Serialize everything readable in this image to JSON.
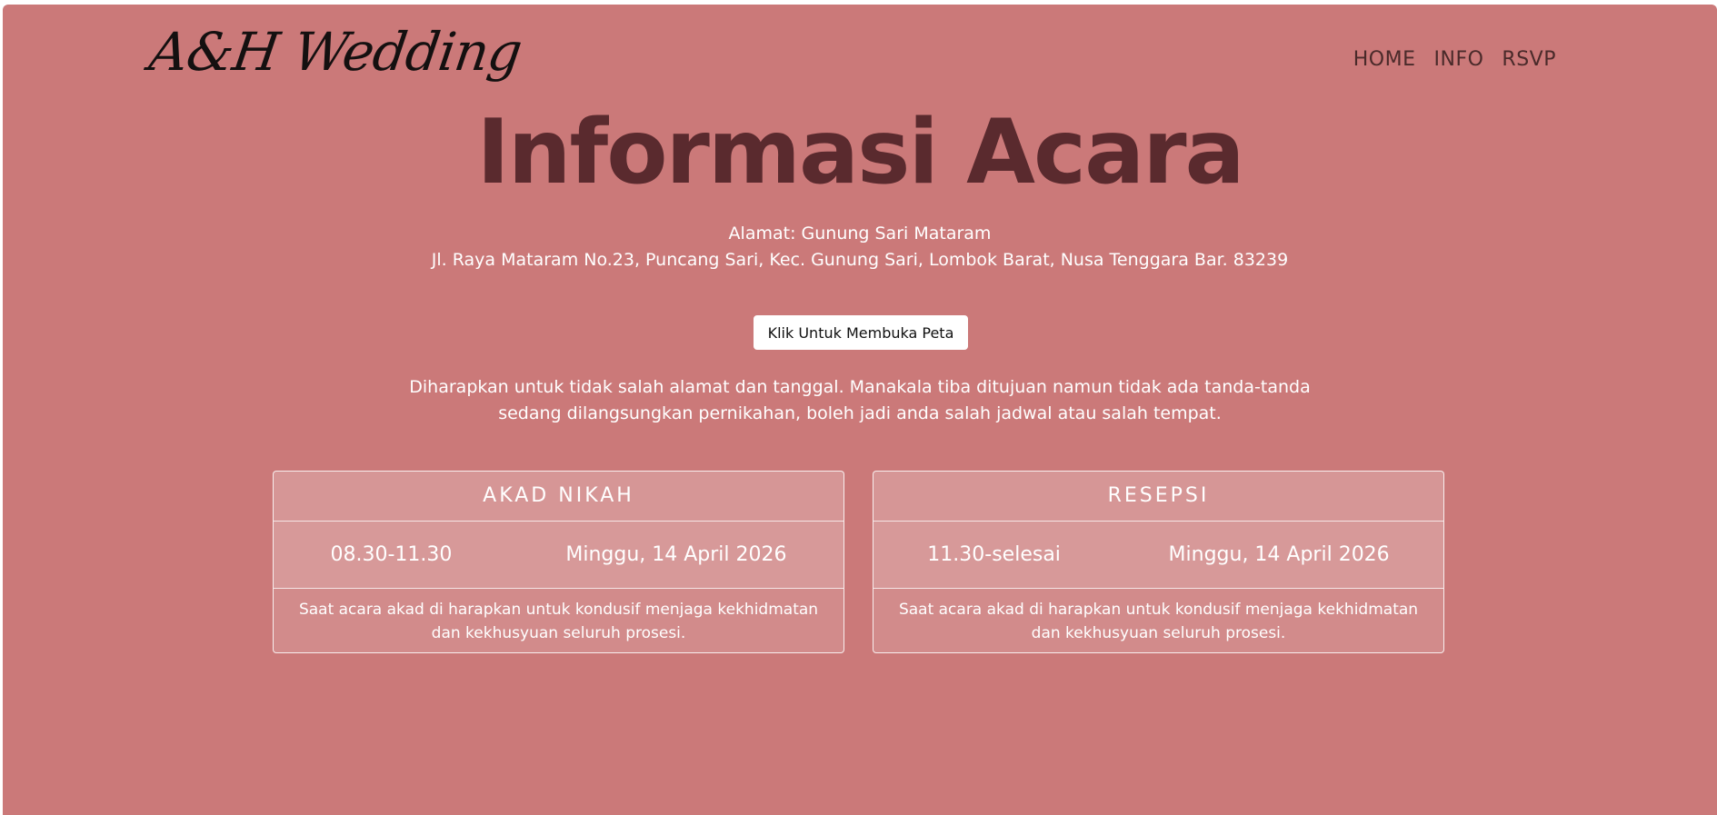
{
  "header": {
    "logo_text": "A&H Wedding",
    "nav": {
      "home": "HOME",
      "info": "INFO",
      "rsvp": "RSVP"
    }
  },
  "main": {
    "title": "Informasi Acara",
    "address_line1": "Alamat: Gunung Sari Mataram",
    "address_line2": "Jl. Raya Mataram No.23, Puncang Sari, Kec. Gunung Sari, Lombok Barat, Nusa Tenggara Bar. 83239",
    "map_button_label": "Klik Untuk Membuka Peta",
    "note": "Diharapkan untuk tidak salah alamat dan tanggal. Manakala tiba ditujuan namun tidak ada tanda-tanda sedang dilangsungkan pernikahan, boleh jadi anda salah jadwal atau salah tempat."
  },
  "events": [
    {
      "title": "AKAD NIKAH",
      "time": "08.30-11.30",
      "date": "Minggu, 14 April 2026",
      "description": "Saat acara akad di harapkan untuk kondusif menjaga kekhidmatan dan kekhusyuan seluruh prosesi."
    },
    {
      "title": "RESEPSI",
      "time": "11.30-selesai",
      "date": "Minggu, 14 April 2026",
      "description": "Saat acara akad di harapkan untuk kondusif menjaga kekhidmatan dan kekhusyuan seluruh prosesi."
    }
  ],
  "colors": {
    "background": "#cb7979",
    "title": "#5a2a2e",
    "text": "#ffffff"
  }
}
